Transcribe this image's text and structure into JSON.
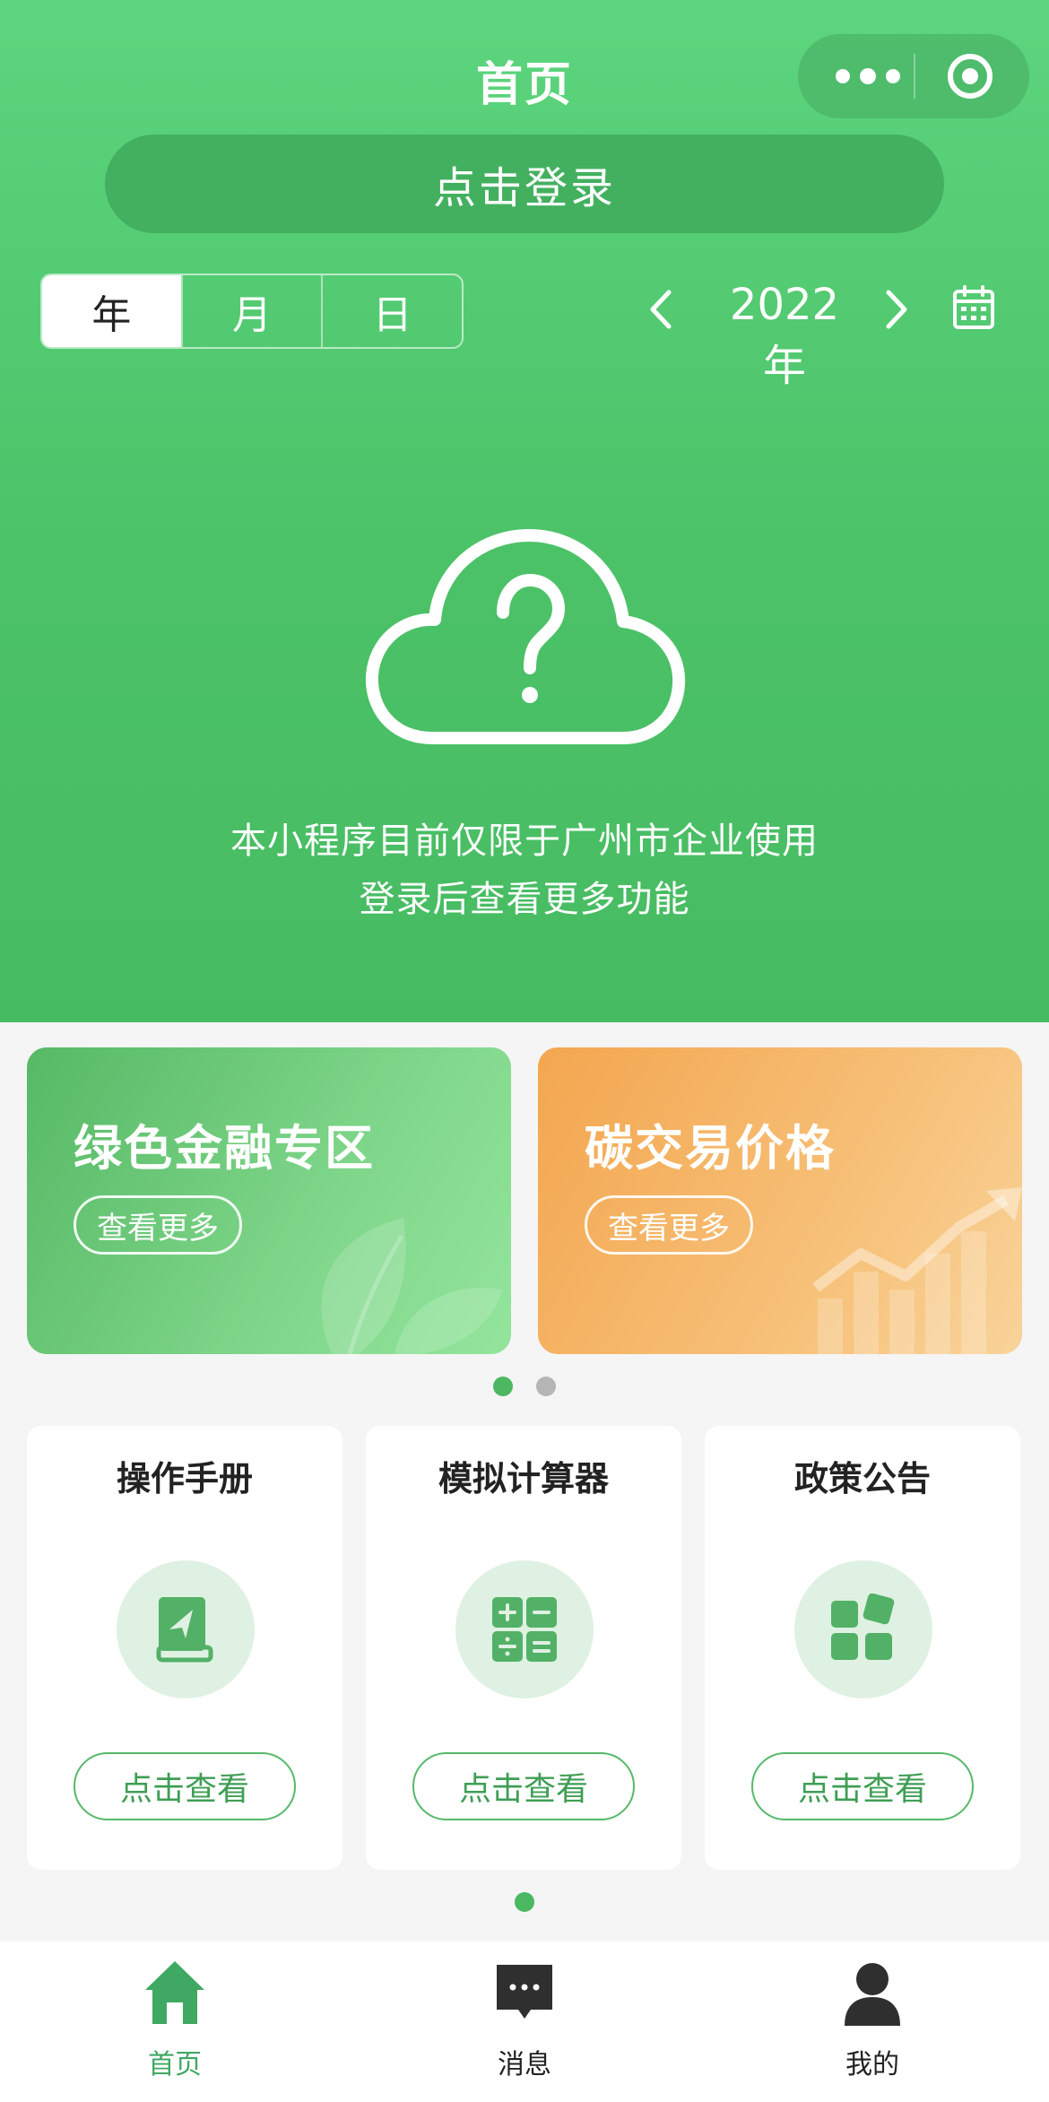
{
  "header": {
    "title": "首页"
  },
  "login": {
    "label": "点击登录"
  },
  "segment": {
    "items": [
      "年",
      "月",
      "日"
    ],
    "selected": "年"
  },
  "year_picker": {
    "label": "2022年"
  },
  "empty_state": {
    "line1": "本小程序目前仅限于广州市企业使用",
    "line2": "登录后查看更多功能"
  },
  "banners": [
    {
      "title": "绿色金融专区",
      "more": "查看更多"
    },
    {
      "title": "碳交易价格",
      "more": "查看更多"
    }
  ],
  "cards": [
    {
      "title": "操作手册",
      "icon": "manual-book-icon",
      "button": "点击查看"
    },
    {
      "title": "模拟计算器",
      "icon": "calculator-icon",
      "button": "点击查看"
    },
    {
      "title": "政策公告",
      "icon": "policy-grid-icon",
      "button": "点击查看"
    }
  ],
  "tabbar": [
    {
      "label": "首页",
      "icon": "home-icon",
      "active": true
    },
    {
      "label": "消息",
      "icon": "message-icon",
      "active": false
    },
    {
      "label": "我的",
      "icon": "user-icon",
      "active": false
    }
  ],
  "colors": {
    "brand_green": "#4cc268",
    "accent_orange": "#f3a64f",
    "tab_active": "#3fa862"
  }
}
